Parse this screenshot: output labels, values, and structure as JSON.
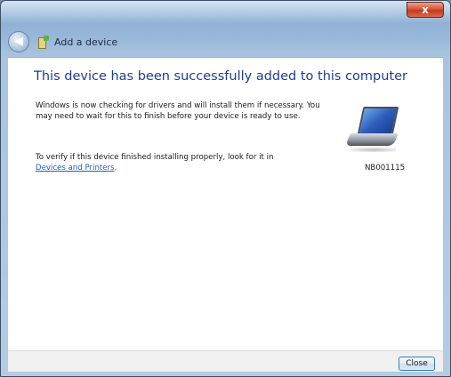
{
  "window": {
    "title_icon": "add-device-icon",
    "nav_title": "Add a device",
    "close_glyph": "x"
  },
  "main": {
    "heading": "This device has been successfully added to this computer",
    "paragraph1": "Windows is now checking for drivers and will install them if necessary. You may need to wait for this to finish before your device is ready to use.",
    "paragraph2_prefix": "To verify if this device finished installing properly, look for it in",
    "paragraph2_link": "Devices and Printers",
    "paragraph2_suffix": "."
  },
  "device": {
    "icon": "laptop-icon",
    "name": "NB001115"
  },
  "footer": {
    "close_label": "Close"
  },
  "colors": {
    "heading": "#1e3d8f",
    "link": "#1f5fc4"
  }
}
